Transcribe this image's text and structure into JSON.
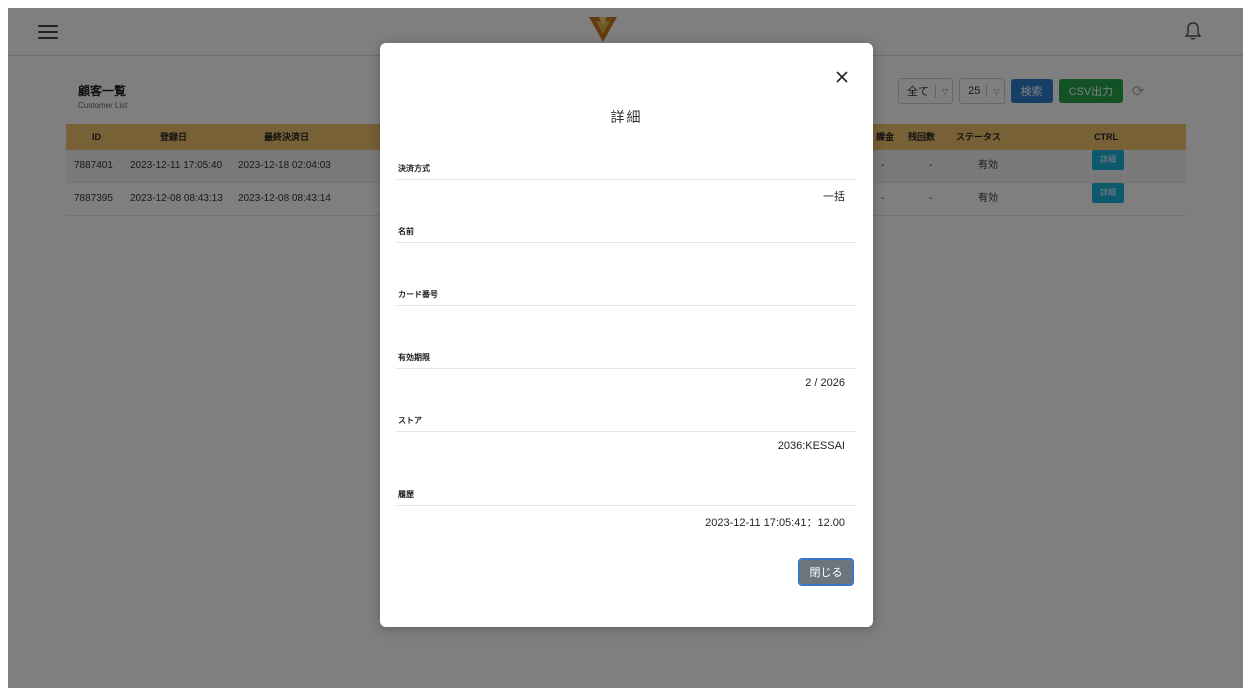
{
  "list": {
    "title": "顧客一覧",
    "subtitle": "Customer List",
    "filter_value": "全て",
    "page_size": "25",
    "search_label": "検索",
    "csv_label": "CSV出力"
  },
  "table": {
    "headers": {
      "id": "ID",
      "registered": "登録日",
      "last_payment": "最終決済日",
      "charge": "課金",
      "remaining": "残回数",
      "status": "ステータス",
      "ctrl": "CTRL"
    },
    "rows": [
      {
        "id": "7887401",
        "registered": "2023-12-11 17:05:40",
        "last_payment": "2023-12-18 02:04:03",
        "charge": "-",
        "remaining": "-",
        "status": "有効",
        "detail": "詳細"
      },
      {
        "id": "7887395",
        "registered": "2023-12-08 08:43:13",
        "last_payment": "2023-12-08 08:43:14",
        "charge": "-",
        "remaining": "-",
        "status": "有効",
        "detail": "詳細"
      }
    ]
  },
  "modal": {
    "title": "詳細",
    "fields": [
      {
        "label": "決済方式",
        "value": "一括"
      },
      {
        "label": "名前",
        "value": ""
      },
      {
        "label": "カード番号",
        "value": ""
      },
      {
        "label": "有効期限",
        "value": "2 / 2026"
      },
      {
        "label": "ストア",
        "value": "2036:KESSAI"
      },
      {
        "label": "履歴",
        "value": "2023-12-11 17:05:41：12.00"
      }
    ],
    "close_label": "閉じる"
  },
  "colors": {
    "header_bar": "#f0c26e",
    "search_button": "#2d7ed0",
    "csv_button": "#26a54a",
    "detail_button": "#1fb3dc",
    "close_button": "#6c757d"
  },
  "icons": [
    "menu-icon",
    "logo-icon",
    "bell-icon",
    "refresh-icon",
    "close-icon",
    "chevron-down-icon"
  ]
}
